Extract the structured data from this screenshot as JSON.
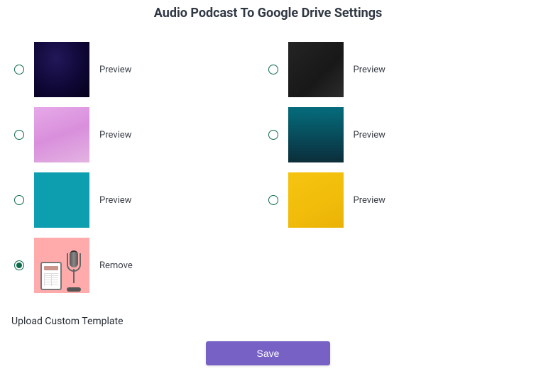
{
  "title": "Audio Podcast To Google Drive Settings",
  "templates": [
    {
      "action_label": "Preview",
      "selected": false,
      "thumb_class": "thumb-dark-purple"
    },
    {
      "action_label": "Preview",
      "selected": false,
      "thumb_class": "thumb-black"
    },
    {
      "action_label": "Preview",
      "selected": false,
      "thumb_class": "thumb-pink"
    },
    {
      "action_label": "Preview",
      "selected": false,
      "thumb_class": "thumb-teal-grad"
    },
    {
      "action_label": "Preview",
      "selected": false,
      "thumb_class": "thumb-teal-flat"
    },
    {
      "action_label": "Preview",
      "selected": false,
      "thumb_class": "thumb-yellow"
    },
    {
      "action_label": "Remove",
      "selected": true,
      "thumb_class": "thumb-custom"
    }
  ],
  "upload_label": "Upload Custom Template",
  "save_label": "Save",
  "colors": {
    "accent": "#7761c5",
    "radio": "#0b6b4b"
  }
}
